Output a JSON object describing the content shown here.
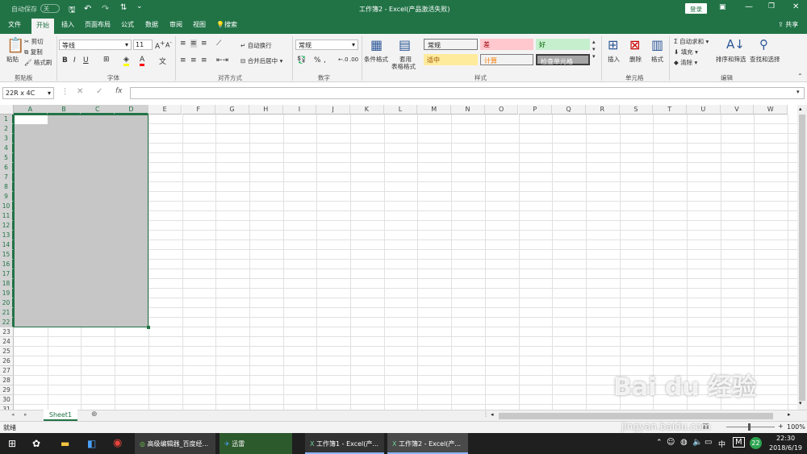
{
  "title_bar": {
    "autosave_label": "自动保存",
    "autosave_state": "关",
    "doc_title": "工作簿2 - Excel(产品激活失败)",
    "login_button": "登录"
  },
  "tabs": [
    "文件",
    "开始",
    "插入",
    "页面布局",
    "公式",
    "数据",
    "审阅",
    "视图"
  ],
  "active_tab": "开始",
  "tell_me": "搜索",
  "share": "共享",
  "ribbon": {
    "clipboard": {
      "paste": "粘贴",
      "cut": "剪切",
      "copy": "复制",
      "format_painter": "格式刷",
      "group": "剪贴板"
    },
    "font": {
      "name": "等线",
      "size": "11",
      "bold": "B",
      "italic": "I",
      "underline": "U",
      "group": "字体"
    },
    "alignment": {
      "wrap": "自动换行",
      "merge": "合并后居中",
      "group": "对齐方式"
    },
    "number": {
      "format": "常规",
      "percent": "%",
      "group": "数字"
    },
    "styles": {
      "conditional": "条件格式",
      "table": "套用\n表格格式",
      "table_line1": "套用",
      "table_line2": "表格格式",
      "cells": [
        {
          "label": "常规",
          "bg": "#ffffff",
          "fg": "#000000"
        },
        {
          "label": "差",
          "bg": "#ffc7ce",
          "fg": "#9c0006"
        },
        {
          "label": "好",
          "bg": "#c6efce",
          "fg": "#006100"
        },
        {
          "label": "适中",
          "bg": "#ffeb9c",
          "fg": "#9c5700"
        },
        {
          "label": "计算",
          "bg": "#f2f2f2",
          "fg": "#fa7d00"
        },
        {
          "label": "检查单元格",
          "bg": "#a5a5a5",
          "fg": "#ffffff"
        }
      ],
      "group": "样式"
    },
    "cells_group": {
      "insert": "插入",
      "delete": "删除",
      "format": "格式",
      "group": "单元格"
    },
    "editing": {
      "autosum": "自动求和",
      "fill": "填充",
      "clear": "清除",
      "sort": "排序和筛选",
      "find": "查找和选择",
      "group": "编辑"
    }
  },
  "name_box": "22R x 4C",
  "fx": "fx",
  "columns": [
    "A",
    "B",
    "C",
    "D",
    "E",
    "F",
    "G",
    "H",
    "I",
    "J",
    "K",
    "L",
    "M",
    "N",
    "O",
    "P",
    "Q",
    "R",
    "S",
    "T",
    "U",
    "V",
    "W"
  ],
  "rows": [
    "1",
    "2",
    "3",
    "4",
    "5",
    "6",
    "7",
    "8",
    "9",
    "10",
    "11",
    "12",
    "13",
    "14",
    "15",
    "16",
    "17",
    "18",
    "19",
    "20",
    "21",
    "22",
    "23",
    "24",
    "25",
    "26",
    "27",
    "28",
    "29",
    "30",
    "31"
  ],
  "selection": {
    "cols": 4,
    "rows": 22
  },
  "sheet_tab": "Sheet1",
  "status": "就绪",
  "zoom": "100%",
  "taskbar": {
    "items": [
      "高级编辑器_百度经...",
      "迅雷",
      "工作簿1 - Excel(产...",
      "工作簿2 - Excel(产..."
    ],
    "time": "22:30",
    "date": "2018/6/19",
    "ime": "中",
    "badge": "22"
  },
  "watermark": {
    "line1": "Bai du 经验",
    "line2": "jingyan.baidu.com"
  },
  "colors": {
    "excel_green": "#217346",
    "selection": "#c6c6c6"
  }
}
